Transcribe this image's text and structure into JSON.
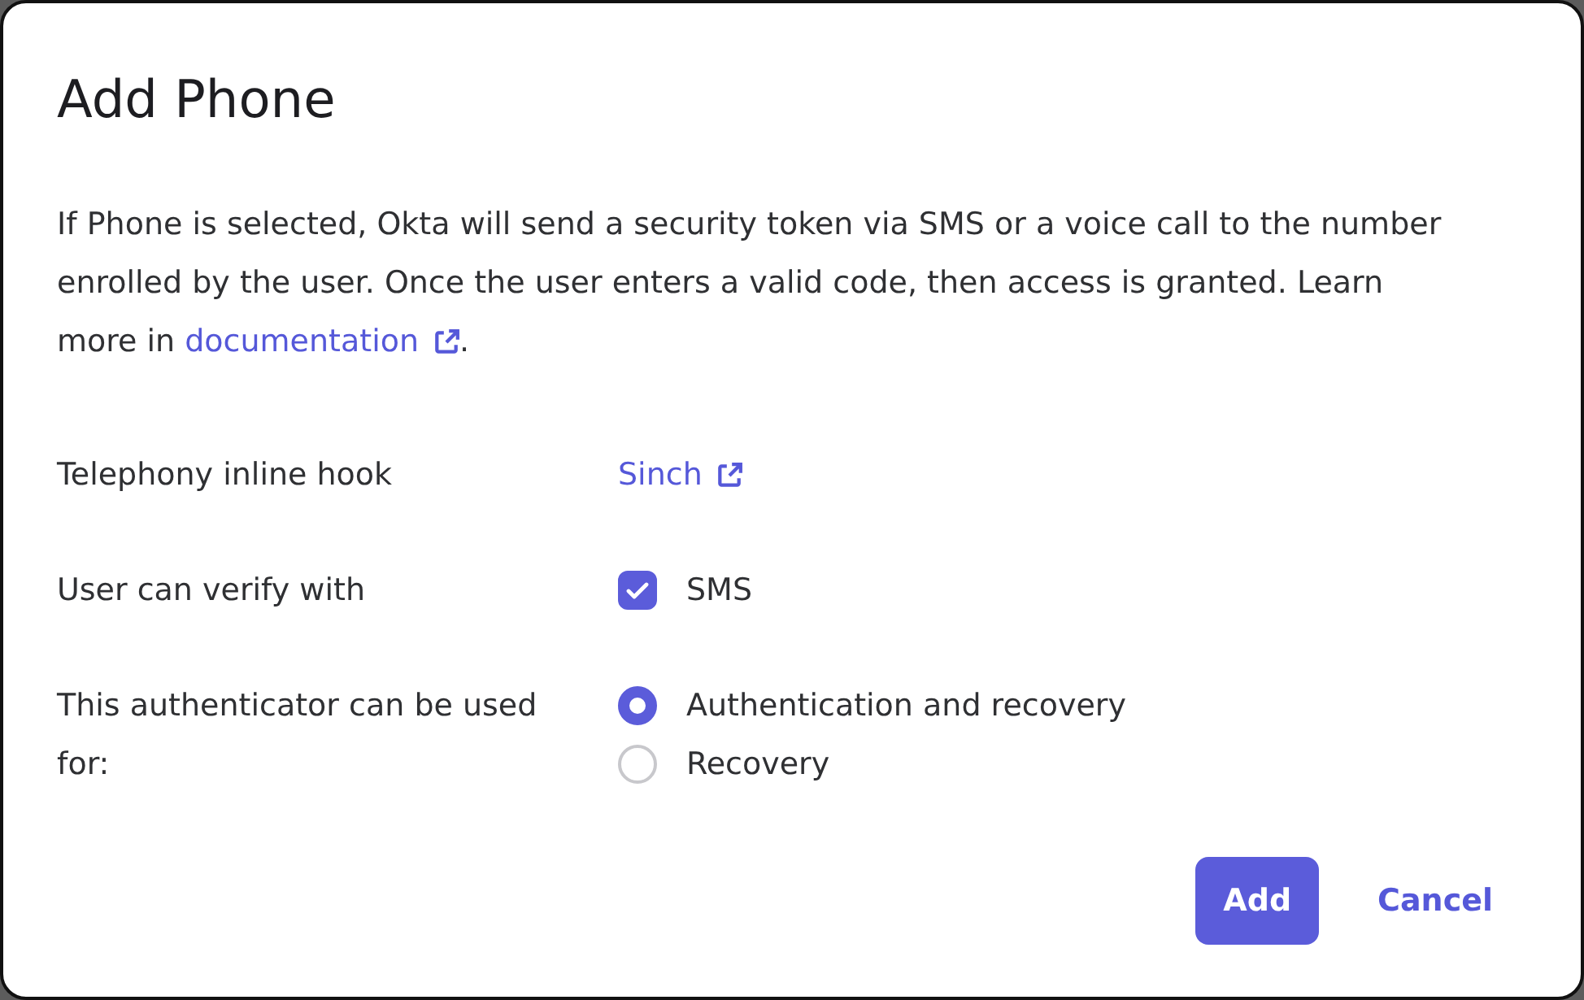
{
  "dialog": {
    "title": "Add Phone",
    "description": {
      "text": "If Phone is selected, Okta will send a security token via SMS or a voice call to the number enrolled by the user. Once the user enters a valid code, then access is granted. Learn more in",
      "link": "documentation",
      "end": "."
    },
    "rows": [
      {
        "kind": "link",
        "label": "Telephony inline hook",
        "link": "Sinch"
      },
      {
        "kind": "checkbox",
        "label": "User can verify with",
        "options": [
          {
            "label": "SMS",
            "checked": true
          }
        ]
      },
      {
        "kind": "radio",
        "label": "This authenticator can be used for:",
        "options": [
          {
            "label": "Authentication and recovery",
            "selected": true
          },
          {
            "label": "Recovery",
            "selected": false
          }
        ]
      }
    ],
    "buttons": [
      {
        "kind": "primary",
        "label": "Add"
      },
      {
        "kind": "text",
        "label": "Cancel"
      }
    ]
  }
}
